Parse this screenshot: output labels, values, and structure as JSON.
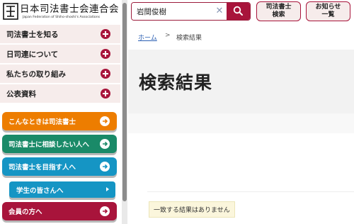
{
  "logo": {
    "title": "日本司法書士会連合会",
    "subtitle": "Japan Federation of Shiho-shoshi's Associations"
  },
  "sidebar": {
    "menu_items": [
      {
        "label": "司法書士を知る",
        "icon": "plus-circle-icon"
      },
      {
        "label": "日司連について",
        "icon": "plus-circle-icon"
      },
      {
        "label": "私たちの取り組み",
        "icon": "plus-circle-icon"
      },
      {
        "label": "公表資料",
        "icon": "plus-circle-icon"
      }
    ],
    "pills": [
      {
        "label": "こんなときは司法書士",
        "color": "#ed7d00",
        "icon": "arrow-right-icon"
      },
      {
        "label": "司法書士に相談したい人へ",
        "color": "#1a8a68",
        "icon": "arrow-right-icon"
      },
      {
        "label": "司法書士を目指す人へ",
        "color": "#1595c4",
        "icon": "arrow-right-icon"
      },
      {
        "label": "学生の皆さんへ",
        "color": "#1595c4",
        "icon": "caret-right-icon"
      },
      {
        "label": "会員の方へ",
        "color": "#a8143b",
        "icon": "arrow-right-icon"
      }
    ]
  },
  "header": {
    "search": {
      "value": "岩間俊樹",
      "clear_icon": "close-icon",
      "button_icon": "search-icon"
    },
    "buttons": [
      {
        "line1": "司法書士",
        "line2": "検索"
      },
      {
        "line1": "お知らせ",
        "line2": "一覧"
      }
    ]
  },
  "breadcrumb": {
    "home": "ホーム",
    "separator": ">",
    "current": "検索結果"
  },
  "main": {
    "title": "検索結果",
    "no_results": "一致する結果はありません"
  },
  "colors": {
    "accent": "#a8143b",
    "menu_bg": "#f6eceb"
  }
}
